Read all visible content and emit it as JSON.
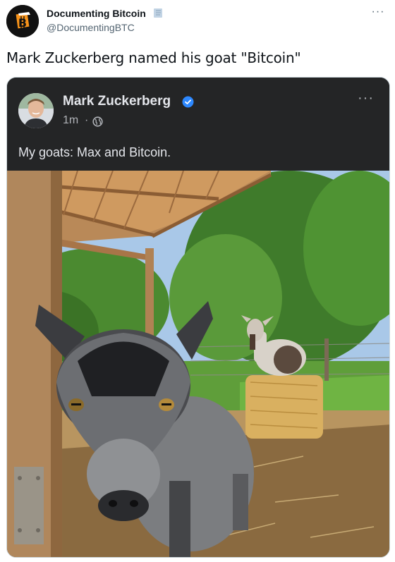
{
  "tweet": {
    "author_name": "Documenting Bitcoin",
    "author_handle": "@DocumentingBTC",
    "more_label": "···",
    "text": "Mark Zuckerberg named his goat \"Bitcoin\""
  },
  "embedded_post": {
    "author_name": "Mark Zuckerberg",
    "time": "1m",
    "separator": "·",
    "more_label": "···",
    "text": "My goats: Max and Bitcoin."
  },
  "icons": {
    "account_avatar": "documenting-bitcoin-logo",
    "label_icon": "book-icon",
    "verified": "verified-badge-icon",
    "audience": "globe-icon"
  },
  "colors": {
    "bitcoin_orange": "#f7931a",
    "facebook_dark": "#242526",
    "verified_blue": "#2d88ff"
  }
}
